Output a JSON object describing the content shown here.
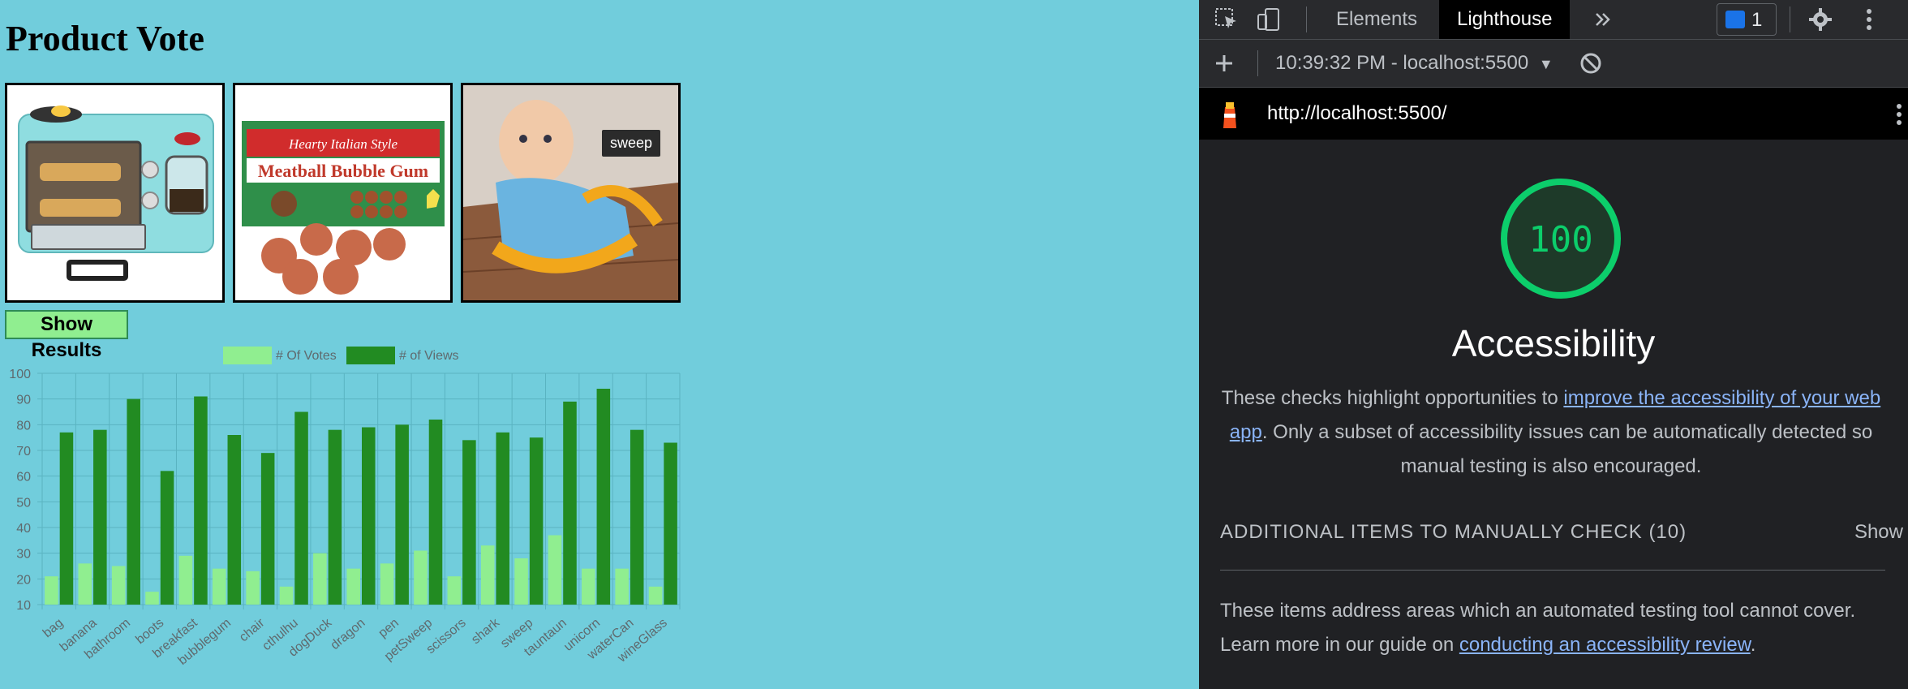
{
  "page": {
    "title": "Product Vote",
    "tooltip": "sweep",
    "show_results": "Show Results",
    "products": [
      "breakfast",
      "bubblegum",
      "sweep"
    ]
  },
  "chart_data": {
    "type": "bar",
    "categories": [
      "bag",
      "banana",
      "bathroom",
      "boots",
      "breakfast",
      "bubblegum",
      "chair",
      "cthulhu",
      "dogDuck",
      "dragon",
      "pen",
      "petSweep",
      "scissors",
      "shark",
      "sweep",
      "tauntaun",
      "unicorn",
      "waterCan",
      "wineGlass"
    ],
    "series": [
      {
        "name": "# Of Votes",
        "color": "#90ee90",
        "values": [
          21,
          26,
          25,
          15,
          29,
          24,
          23,
          17,
          30,
          24,
          26,
          31,
          21,
          33,
          28,
          37,
          24,
          24,
          17
        ]
      },
      {
        "name": "# of Views",
        "color": "#228b22",
        "values": [
          77,
          78,
          90,
          62,
          91,
          76,
          69,
          85,
          78,
          79,
          80,
          82,
          74,
          77,
          75,
          89,
          94,
          78,
          73
        ]
      }
    ],
    "ylim": [
      10,
      100
    ],
    "yticks": [
      10,
      20,
      30,
      40,
      50,
      60,
      70,
      80,
      90,
      100
    ],
    "legend": "top",
    "grid": true
  },
  "devtools": {
    "tabs": [
      "Elements",
      "Lighthouse"
    ],
    "active_tab": "Lighthouse",
    "issues_count": "1",
    "report_time": "10:39:32 PM - localhost:5500",
    "url": "http://localhost:5500/",
    "score": "100",
    "category": "Accessibility",
    "desc_pre": "These checks highlight opportunities to ",
    "desc_link": "improve the accessibility of your web app",
    "desc_post": ". Only a subset of accessibility issues can be automatically detected so manual testing is also encouraged.",
    "manual_header": "ADDITIONAL ITEMS TO MANUALLY CHECK (10)",
    "show_label": "Show",
    "manual_pre": "These items address areas which an automated testing tool cannot cover. Learn more in our guide on ",
    "manual_link": "conducting an accessibility review",
    "manual_post": ".",
    "score_color": "#0cce6b"
  }
}
